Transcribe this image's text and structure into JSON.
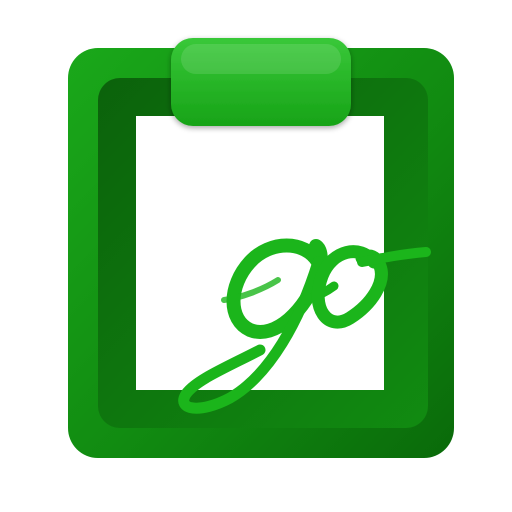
{
  "icon": {
    "name": "clipboard-go-icon",
    "logo_text": "go"
  },
  "colors": {
    "background": "#ffffff",
    "frame_light": "#1aa81a",
    "frame_mid": "#118b11",
    "frame_dark": "#0a6a0a",
    "inner_border_dark": "#0b620b",
    "paper": "#ffffff",
    "clip_top": "#39c839",
    "clip_bottom": "#17a317",
    "script_green": "#1bb51b"
  }
}
